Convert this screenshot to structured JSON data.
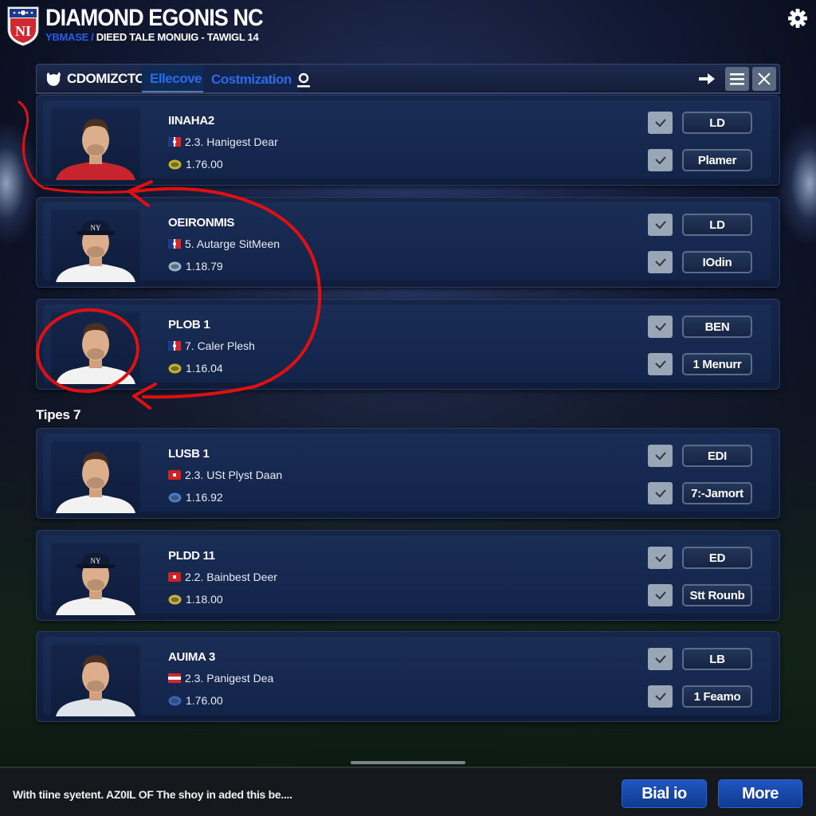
{
  "header": {
    "title": "DIAMOND EGONIS NC",
    "subtitle_accent": "YBMASE /",
    "subtitle": "DIEED TALE MONUIG - TAWIGL 14",
    "settings_icon": "gear-icon"
  },
  "tabbar": {
    "brand_label": "CDOMIZCTON",
    "tabs": [
      {
        "label": "Ellecove",
        "active": true
      },
      {
        "label": "Costmization",
        "active": false
      }
    ],
    "search_icon": "search-icon",
    "right_icons": [
      "arrow-right-icon",
      "menu-icon",
      "close-icon"
    ]
  },
  "section_label": "Tipes 7",
  "players": [
    {
      "name": "IINAHA2",
      "line1": "2.3. Hanigest Dear",
      "line2": "1.76.00",
      "flag": "mlb",
      "shirt": "#c8242e",
      "hat": false,
      "btn1": "LD",
      "btn2": "Plamer",
      "checked1": true,
      "checked2": true
    },
    {
      "name": "OEIRONMIS",
      "line1": "5. Autarge SitMeen",
      "line2": "1.18.79",
      "flag": "mlb",
      "shirt": "#f2f2f2",
      "hat": true,
      "btn1": "LD",
      "btn2": "IOdin",
      "checked1": true,
      "checked2": true
    },
    {
      "name": "PLOB 1",
      "line1": "7. Caler Plesh",
      "line2": "1.16.04",
      "flag": "mlb",
      "shirt": "#f2f2f2",
      "hat": false,
      "btn1": "BEN",
      "btn2": "1 Menurr",
      "checked1": true,
      "checked2": true
    },
    {
      "name": "LUSB 1",
      "line1": "2.3. USt Plyst Daan",
      "line2": "1.16.92",
      "flag": "red",
      "shirt": "#f2f2f2",
      "hat": false,
      "btn1": "EDI",
      "btn2": "7:-Jamort",
      "checked1": true,
      "checked2": true
    },
    {
      "name": "PLDD 11",
      "line1": "2.2. Bainbest Deer",
      "line2": "1.18.00",
      "flag": "red",
      "shirt": "#f2f2f2",
      "hat": true,
      "btn1": "ED",
      "btn2": "Stt Rounb",
      "checked1": true,
      "checked2": true
    },
    {
      "name": "AUIMA 3",
      "line1": "2.3. Panigest Dea",
      "line2": "1.76.00",
      "flag": "stripe",
      "shirt": "#dfe3ea",
      "hat": false,
      "btn1": "LB",
      "btn2": "1 Feamo",
      "checked1": true,
      "checked2": true
    }
  ],
  "footer": {
    "text": "With tiine syetent.  AZ0IL OF The shoy in aded this be....",
    "button1": "Bial io",
    "button2": "More"
  },
  "colors": {
    "accent_blue": "#2b6be8",
    "annotation_red": "#e01010",
    "footer_button": "#1a4fb5"
  }
}
